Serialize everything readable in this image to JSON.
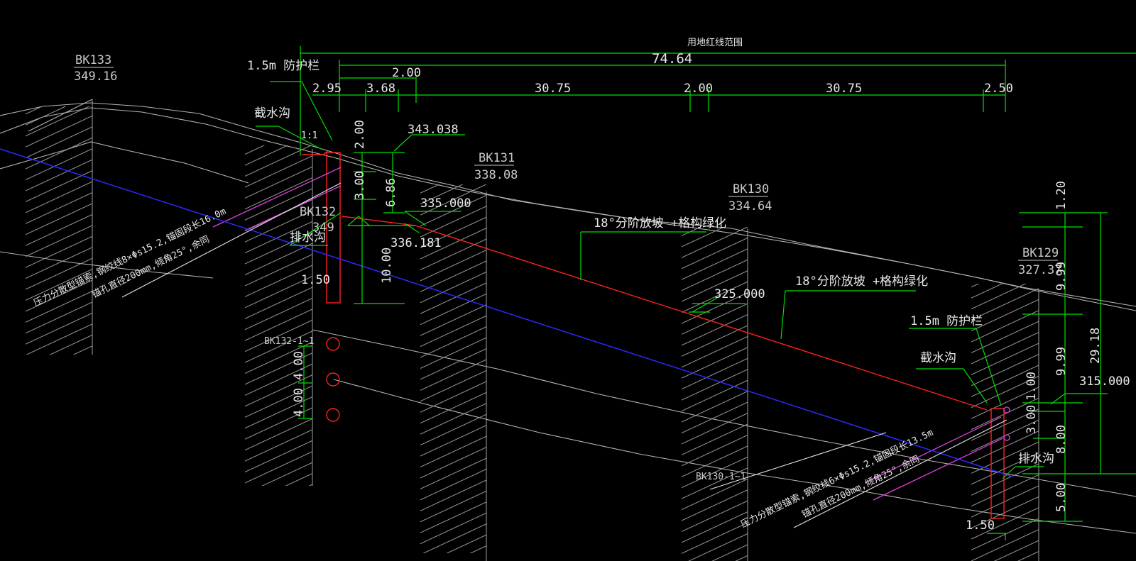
{
  "top_label": "用地红线范围",
  "dims_top": {
    "total": "74.64",
    "d2_00_a": "2.00",
    "d2_95": "2.95",
    "d3_68": "3.68",
    "d30_75_a": "30.75",
    "d2_00_b": "2.00",
    "d30_75_b": "30.75",
    "d2_50": "2.50"
  },
  "boreholes": [
    {
      "name": "BK133",
      "elev": "349.16"
    },
    {
      "name": "BK131",
      "elev": "338.08"
    },
    {
      "name": "BK130",
      "elev": "334.64"
    },
    {
      "name": "BK129",
      "elev": "327.37"
    },
    {
      "name": "BK132",
      "elev": "349"
    }
  ],
  "left_features": {
    "guardrail": "1.5m  防护栏",
    "intercept_ditch": "截水沟",
    "drain_ditch": "排水沟",
    "small_label": "1:1",
    "elev_343": "343.038",
    "elev_335": "335.000",
    "elev_336": "336.181",
    "v2_00": "2.00",
    "v3_00": "3.00",
    "v6_86": "6.86",
    "v10_00": "10.00",
    "v1_50": "1.50",
    "v4_00_a": "4.00",
    "v4_00_b": "4.00",
    "sec_label": "BK132-1~1",
    "anchor_note_1": "压力分散型锚索,钢绞线8×Φs15.2,锚固段长16.0m",
    "anchor_note_2": "锚孔直径200mm,倾角25°,余同"
  },
  "middle_features": {
    "slope_note_1": "18°分阶放坡 +格构绿化",
    "slope_note_2": "18°分阶放坡 +格构绿化",
    "elev_325": "325.000",
    "sec_label": "BK130-1~1"
  },
  "right_features": {
    "guardrail": "1.5m  防护栏",
    "intercept_ditch": "截水沟",
    "drain_ditch": "排水沟",
    "elev_315": "315.000",
    "v1_20": "1.20",
    "v9_99_a": "9.99",
    "v9_99_b": "9.99",
    "v29_18": "29.18",
    "v1_00": "1.00",
    "v3_00": "3.00",
    "v8_00": "8.00",
    "v5_00": "5.00",
    "v1_50": "1.50",
    "anchor_note_1": "压力分散型锚索,钢绞线6×Φs15.2,锚固段长13.5m",
    "anchor_note_2": "锚孔直径200mm,倾角25°,余同"
  },
  "colors": {
    "background": "#000000",
    "dimension": "#00e000",
    "red": "#ff2020",
    "magenta": "#e040e0",
    "blue": "#2a2aff",
    "ground": "#b4b4b4"
  }
}
